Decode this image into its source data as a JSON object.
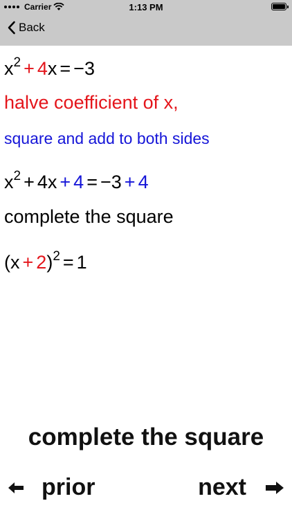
{
  "status_bar": {
    "carrier": "Carrier",
    "time": "1:13 PM"
  },
  "nav_bar": {
    "back_label": "Back"
  },
  "steps": {
    "eq1": {
      "x": "x",
      "exp": "2",
      "plus": "+",
      "coef": "4",
      "x2": "x",
      "eq": "=",
      "rhs": "−3"
    },
    "caption1": "halve coefficient of x,",
    "caption2": "square and add to both sides",
    "eq2": {
      "x": "x",
      "exp": "2",
      "plus1": "+",
      "term": "4x",
      "plus2": "+",
      "add": "4",
      "eq": "=",
      "rhs": "−3",
      "plus3": "+",
      "add2": "4"
    },
    "caption3": "complete the square",
    "eq3": {
      "open": "(x",
      "plus": "+",
      "num": "2",
      "close": ")",
      "exp": "2",
      "eq": "=",
      "rhs": "1"
    }
  },
  "footer": {
    "title": "complete the square",
    "prior_label": "prior",
    "next_label": "next"
  },
  "colors": {
    "red": "#e4151b",
    "blue": "#1515d8",
    "bar": "#c9c9c9"
  }
}
